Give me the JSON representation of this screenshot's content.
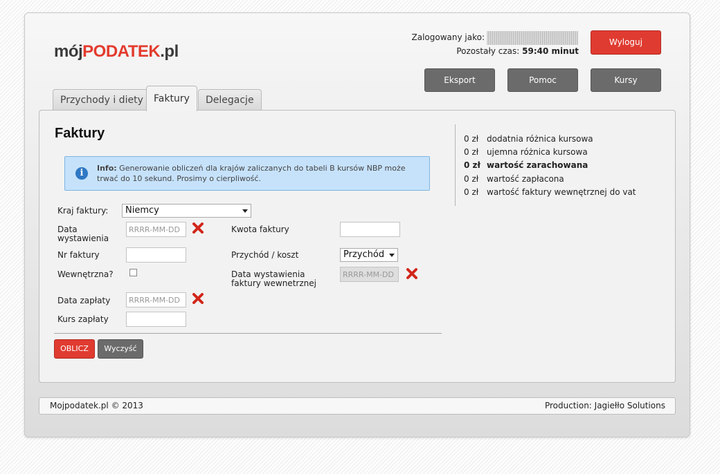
{
  "header": {
    "logo_prefix": "mój",
    "logo_main": "PODATEK",
    "logo_suffix": ".pl",
    "logged_in_label": "Zalogowany jako:",
    "time_label": "Pozostały czas:",
    "time_value": "59:40 minut",
    "logout_label": "Wyloguj",
    "nav": [
      "Eksport",
      "Pomoc",
      "Kursy"
    ]
  },
  "tabs": [
    {
      "label": "Przychody i diety",
      "active": false
    },
    {
      "label": "Faktury",
      "active": true
    },
    {
      "label": "Delegacje",
      "active": false
    }
  ],
  "main": {
    "title": "Faktury",
    "info": {
      "label": "Info:",
      "text": "Generowanie obliczeń dla krajów zaliczanych do tabeli B kursów NBP może trwać do 10 sekund. Prosimy o cierpliwość."
    },
    "form": {
      "country_label": "Kraj faktury:",
      "country_value": "Niemcy",
      "issue_date_label": "Data wystawienia",
      "issue_date_placeholder": "RRRR-MM-DD",
      "invoice_no_label": "Nr faktury",
      "internal_label": "Wewnętrzna?",
      "payment_date_label": "Data zapłaty",
      "payment_date_placeholder": "RRRR-MM-DD",
      "payment_rate_label": "Kurs zapłaty",
      "amount_label": "Kwota faktury",
      "type_label": "Przychód / koszt",
      "type_value": "Przychód",
      "internal_date_label": "Data wystawienia faktury wewnetrznej",
      "internal_date_placeholder": "RRRR-MM-DD"
    },
    "buttons": {
      "calculate": "OBLICZ",
      "clear": "Wyczyść"
    }
  },
  "summary": [
    {
      "amount": "0 zł",
      "label": "dodatnia różnica kursowa",
      "bold": false
    },
    {
      "amount": "0 zł",
      "label": "ujemna różnica kursowa",
      "bold": false
    },
    {
      "amount": "0 zł",
      "label": "wartość zarachowana",
      "bold": true
    },
    {
      "amount": "0 zł",
      "label": "wartość zapłacona",
      "bold": false
    },
    {
      "amount": "0 zł",
      "label": "wartość faktury wewnętrznej do vat",
      "bold": false
    }
  ],
  "footer": {
    "left": "Mojpodatek.pl © 2013",
    "right": "Production: Jagiełło Solutions"
  },
  "colors": {
    "accent": "#e03b30",
    "nav_button": "#6b6b6b",
    "info_bg": "#c6e2fb"
  },
  "icons": [
    "info-icon",
    "clear-x-icon",
    "dropdown-caret-icon"
  ]
}
